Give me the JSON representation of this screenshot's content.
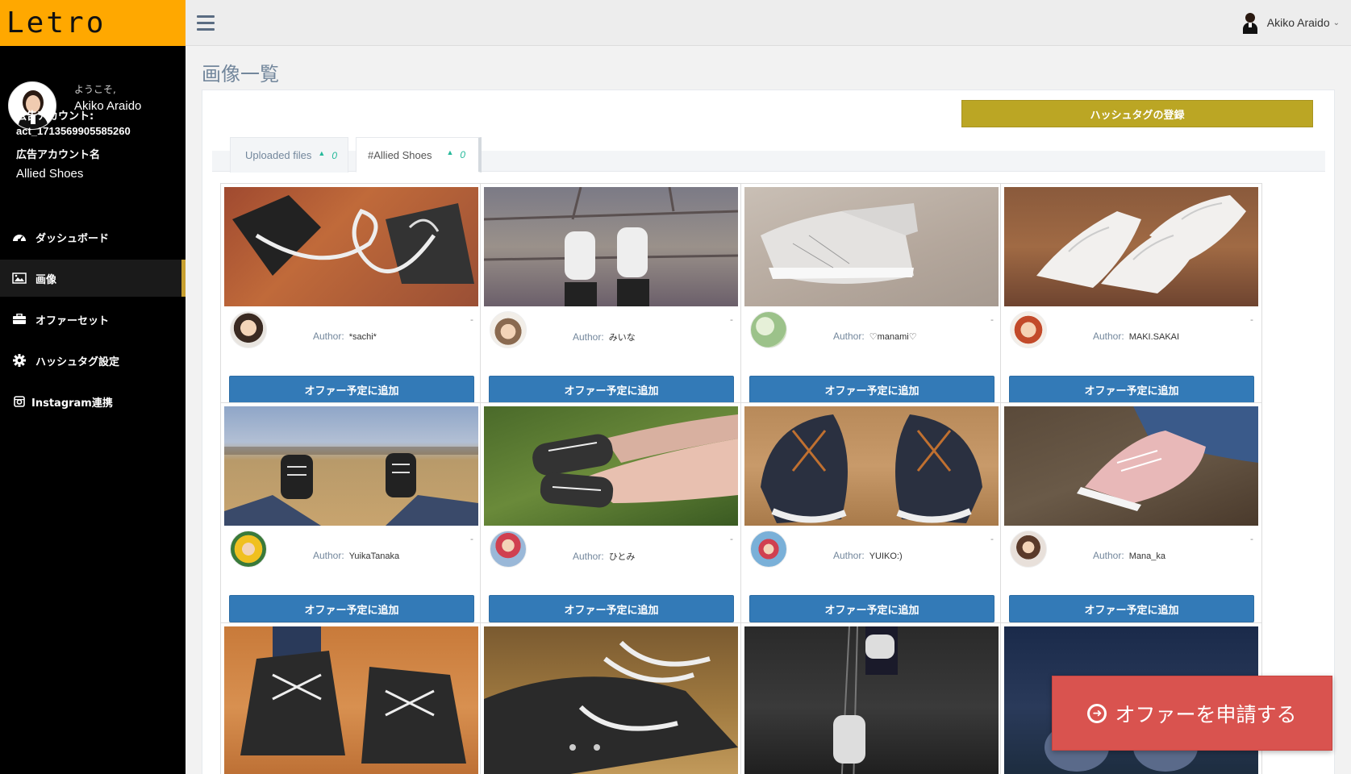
{
  "app": {
    "logo": "Letro"
  },
  "sidebar": {
    "welcome": "ようこそ,",
    "user_name": "Akiko Araido",
    "ad_account_label": "広告アカウント:",
    "ad_account_id": "act_1713569905585260",
    "ad_account_name_label": "広告アカウント名",
    "ad_account_name": "Allied Shoes",
    "nav": [
      {
        "label": "ダッシュボード",
        "icon": "dashboard-icon"
      },
      {
        "label": "画像",
        "icon": "image-icon",
        "active": true
      },
      {
        "label": "オファーセット",
        "icon": "briefcase-icon"
      },
      {
        "label": "ハッシュタグ設定",
        "icon": "gear-icon"
      },
      {
        "label": "Instagram連携",
        "icon": "instagram-icon"
      }
    ]
  },
  "topbar": {
    "user_name": "Akiko Araido"
  },
  "main": {
    "title": "画像一覧",
    "register_hashtag_button": "ハッシュタグの登録",
    "tabs": [
      {
        "label": "Uploaded files",
        "count": "0"
      },
      {
        "label": "#Allied Shoes",
        "count": "0"
      }
    ],
    "author_label": "Author:",
    "add_button_label": "オファー予定に追加",
    "cards": [
      {
        "author": "*sachi*",
        "meta": "-"
      },
      {
        "author": "みいな",
        "meta": "-"
      },
      {
        "author": "♡manami♡",
        "meta": "-"
      },
      {
        "author": "MAKI.SAKAI",
        "meta": "-"
      },
      {
        "author": "YuikaTanaka",
        "meta": "-"
      },
      {
        "author": "ひとみ",
        "meta": "-"
      },
      {
        "author": "YUIKO:)",
        "meta": "-"
      },
      {
        "author": "Mana_ka",
        "meta": "-"
      }
    ]
  },
  "floating_button": {
    "label": "オファーを申請する"
  }
}
